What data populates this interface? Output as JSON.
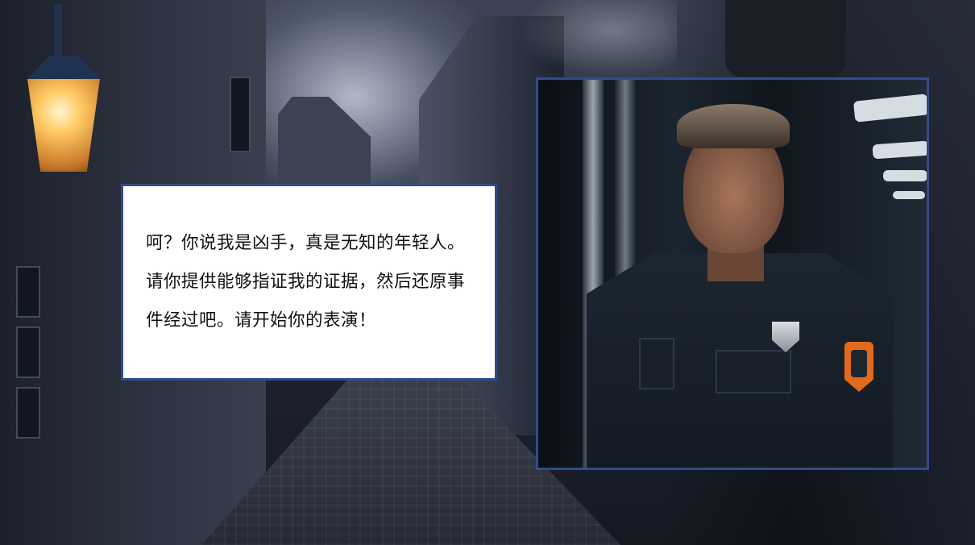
{
  "dialog": {
    "text": "呵？你说我是凶手，真是无知的年轻人。请你提供能够指证我的证据，然后还原事件经过吧。请开始你的表演！"
  },
  "portrait": {
    "subject": "police-officer-suspect"
  },
  "colors": {
    "frame_border": "#2f4d8c",
    "dialog_background": "#ffffff",
    "dialog_text": "#111111"
  }
}
